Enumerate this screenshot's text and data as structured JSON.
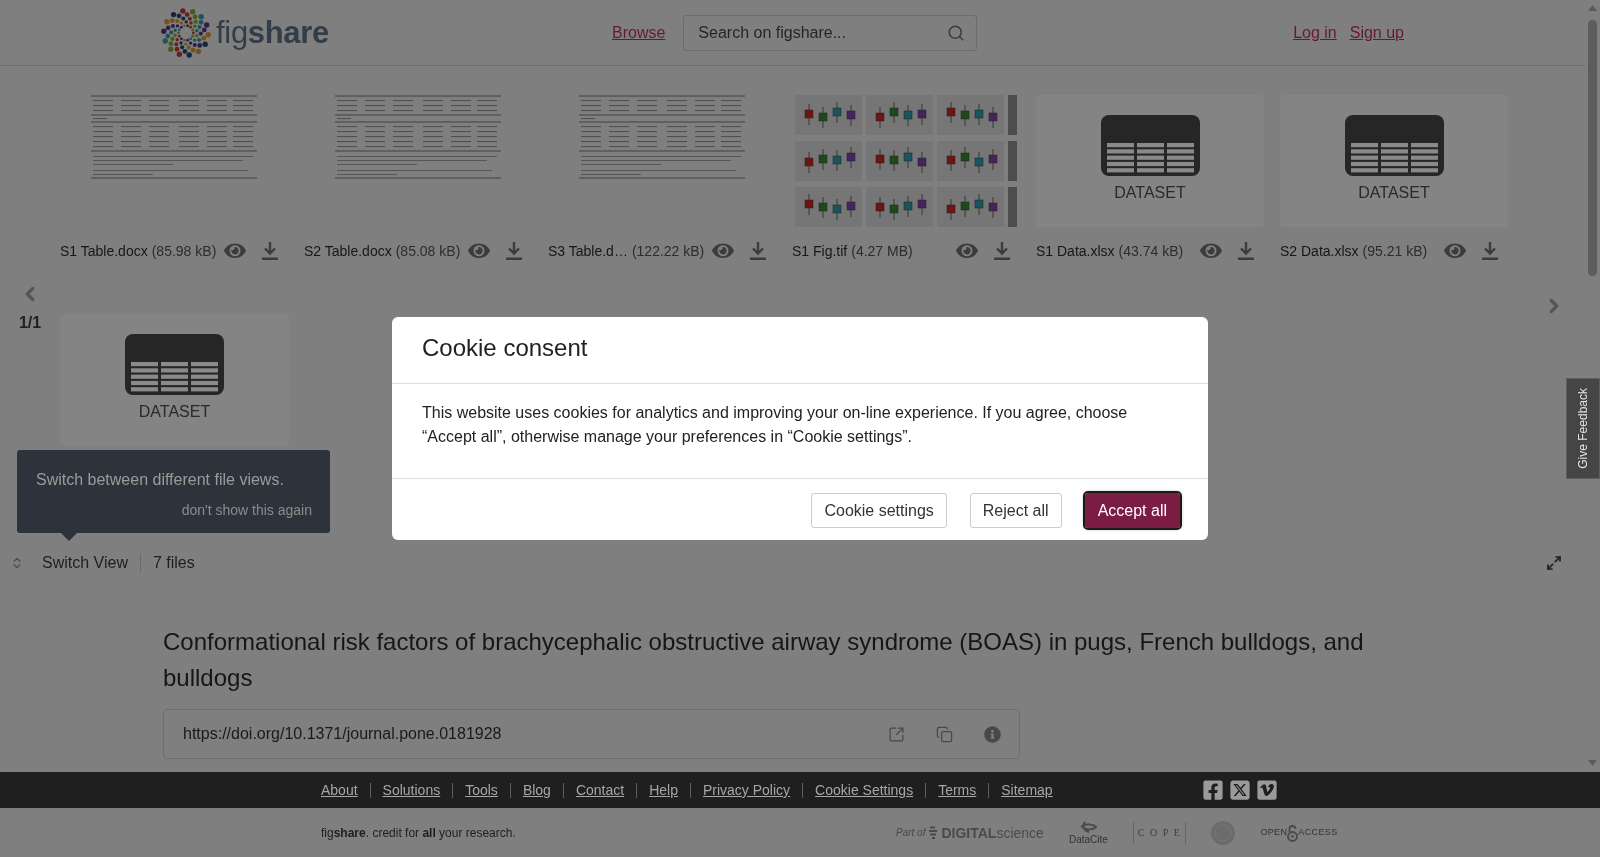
{
  "header": {
    "logo": "fig**share**",
    "nav_link": "Browse",
    "search": {
      "placeholder": "Search on figshare..."
    },
    "auth_links": [
      "Log in",
      "Sign up"
    ]
  },
  "file_viewer": {
    "files": [
      {
        "kind": "document",
        "name": "S1 Table.docx",
        "size": "(85.98 kB)"
      },
      {
        "kind": "document",
        "name": "S2 Table.docx",
        "size": "(85.08 kB)"
      },
      {
        "kind": "document",
        "name": "S3 Table.d…",
        "size": "(122.22 kB)"
      },
      {
        "kind": "figure",
        "name": "S1 Fig.tif",
        "size": "(4.27 MB)"
      },
      {
        "kind": "dataset",
        "name": "S1 Data.xlsx",
        "size": "(43.74 kB)",
        "preview_label": "DATASET"
      },
      {
        "kind": "dataset",
        "name": "S2 Data.xlsx",
        "size": "(95.21 kB)",
        "preview_label": "DATASET"
      }
    ],
    "page_indicator": "1/1",
    "next_row": [
      {
        "kind": "dataset",
        "preview_label": "DATASET"
      }
    ],
    "tooltip": {
      "text": "Switch between different file views.",
      "dismiss": "don't show this again"
    },
    "toolbar": {
      "switch_view": "Switch View",
      "file_count": "7 files"
    }
  },
  "article": {
    "title": "Conformational risk factors of brachycephalic obstructive airway syndrome (BOAS) in pugs, French bulldogs, and bulldogs",
    "doi": "https://doi.org/10.1371/journal.pone.0181928"
  },
  "cookie_dialog": {
    "title": "Cookie consent",
    "message": "This website uses cookies for analytics and improving your on-line experience. If you agree, choose “Accept all”, otherwise manage your preferences in “Cookie settings”.",
    "buttons": [
      {
        "label": "Cookie settings",
        "kind": "secondary",
        "focused": false
      },
      {
        "label": "Reject all",
        "kind": "secondary",
        "focused": false
      },
      {
        "label": "Accept all",
        "kind": "primary",
        "focused": true
      }
    ]
  },
  "feedback_tab": "Give Feedback",
  "footer": {
    "links": [
      "About",
      "Solutions",
      "Tools",
      "Blog",
      "Contact",
      "Help",
      "Privacy Policy",
      "Cookie Settings",
      "Terms",
      "Sitemap"
    ],
    "tagline": "fig**share**. credit for **all** your research.",
    "partners": [
      {
        "kind": "digital_science",
        "label": "Part of",
        "wordmark": "**DIGITAL**science"
      },
      {
        "kind": "datacite",
        "wordmark": "DataCite"
      },
      {
        "kind": "cope",
        "wordmark": "COPE"
      },
      {
        "kind": "seal"
      },
      {
        "kind": "open_access",
        "words": [
          "OPEN",
          "ACCESS"
        ]
      }
    ]
  }
}
